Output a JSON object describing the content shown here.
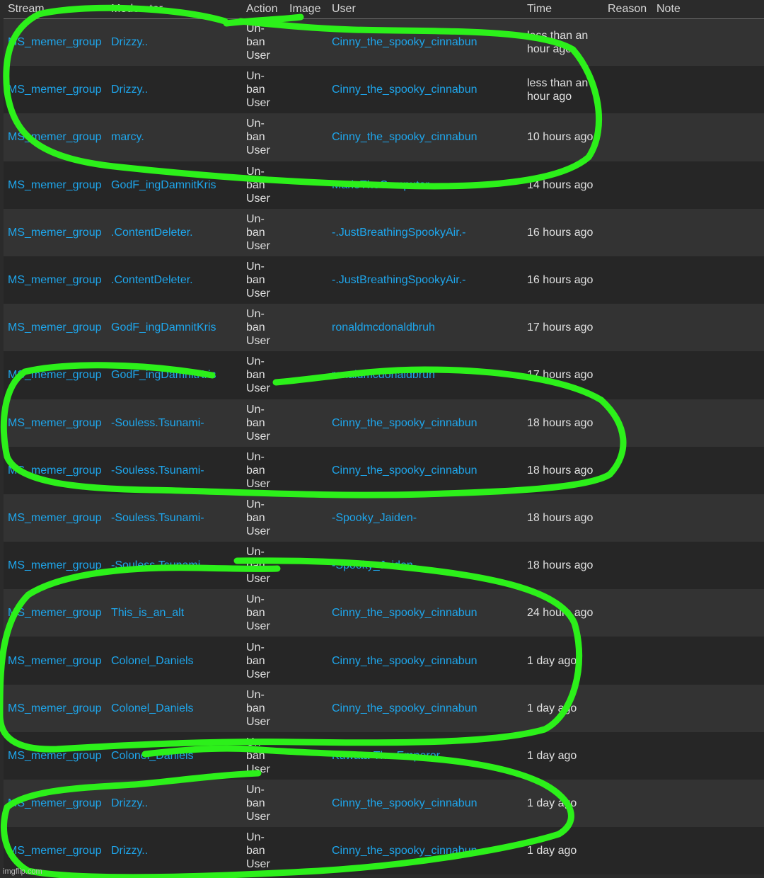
{
  "columns": [
    "Stream",
    "Moderator",
    "Action",
    "Image",
    "User",
    "Time",
    "Reason",
    "Note"
  ],
  "rows": [
    {
      "stream": "MS_memer_group",
      "moderator": "Drizzy..",
      "action": [
        "Un-",
        "ban",
        "User"
      ],
      "user": "Cinny_the_spooky_cinnabun",
      "time": "less than an hour ago"
    },
    {
      "stream": "MS_memer_group",
      "moderator": "Drizzy..",
      "action": [
        "Un-",
        "ban",
        "User"
      ],
      "user": "Cinny_the_spooky_cinnabun",
      "time": "less than an hour ago"
    },
    {
      "stream": "MS_memer_group",
      "moderator": "marcy.",
      "action": [
        "Un-",
        "ban",
        "User"
      ],
      "user": "Cinny_the_spooky_cinnabun",
      "time": "10 hours ago"
    },
    {
      "stream": "MS_memer_group",
      "moderator": "GodF_ingDamnitKris",
      "action": [
        "Un-",
        "ban",
        "User"
      ],
      "user": "MarioTheComputer",
      "time": "14 hours ago"
    },
    {
      "stream": "MS_memer_group",
      "moderator": ".ContentDeleter.",
      "action": [
        "Un-",
        "ban",
        "User"
      ],
      "user": "-.JustBreathingSpookyAir.-",
      "time": "16 hours ago"
    },
    {
      "stream": "MS_memer_group",
      "moderator": ".ContentDeleter.",
      "action": [
        "Un-",
        "ban",
        "User"
      ],
      "user": "-.JustBreathingSpookyAir.-",
      "time": "16 hours ago"
    },
    {
      "stream": "MS_memer_group",
      "moderator": "GodF_ingDamnitKris",
      "action": [
        "Un-",
        "ban",
        "User"
      ],
      "user": "ronaldmcdonaldbruh",
      "time": "17 hours ago"
    },
    {
      "stream": "MS_memer_group",
      "moderator": "GodF_ingDamnitKris",
      "action": [
        "Un-",
        "ban",
        "User"
      ],
      "user": "ronaldmcdonaldbruh",
      "time": "17 hours ago"
    },
    {
      "stream": "MS_memer_group",
      "moderator": "-Souless.Tsunami-",
      "action": [
        "Un-",
        "ban",
        "User"
      ],
      "user": "Cinny_the_spooky_cinnabun",
      "time": "18 hours ago"
    },
    {
      "stream": "MS_memer_group",
      "moderator": "-Souless.Tsunami-",
      "action": [
        "Un-",
        "ban",
        "User"
      ],
      "user": "Cinny_the_spooky_cinnabun",
      "time": "18 hours ago"
    },
    {
      "stream": "MS_memer_group",
      "moderator": "-Souless.Tsunami-",
      "action": [
        "Un-",
        "ban",
        "User"
      ],
      "user": "-Spooky_Jaiden-",
      "time": "18 hours ago"
    },
    {
      "stream": "MS_memer_group",
      "moderator": "-Souless.Tsunami-",
      "action": [
        "Un-",
        "ban",
        "User"
      ],
      "user": "-Spooky_Jaiden-",
      "time": "18 hours ago"
    },
    {
      "stream": "MS_memer_group",
      "moderator": "This_is_an_alt",
      "action": [
        "Un-",
        "ban",
        "User"
      ],
      "user": "Cinny_the_spooky_cinnabun",
      "time": "24 hours ago"
    },
    {
      "stream": "MS_memer_group",
      "moderator": "Colonel_Daniels",
      "action": [
        "Un-",
        "ban",
        "User"
      ],
      "user": "Cinny_the_spooky_cinnabun",
      "time": "1 day ago"
    },
    {
      "stream": "MS_memer_group",
      "moderator": "Colonel_Daniels",
      "action": [
        "Un-",
        "ban",
        "User"
      ],
      "user": "Cinny_the_spooky_cinnabun",
      "time": "1 day ago"
    },
    {
      "stream": "MS_memer_group",
      "moderator": "Colonel_Daniels",
      "action": [
        "Un-",
        "ban",
        "User"
      ],
      "user": "Kuwata-The-Emperor",
      "time": "1 day ago"
    },
    {
      "stream": "MS_memer_group",
      "moderator": "Drizzy..",
      "action": [
        "Un-",
        "ban",
        "User"
      ],
      "user": "Cinny_the_spooky_cinnabun",
      "time": "1 day ago"
    },
    {
      "stream": "MS_memer_group",
      "moderator": "Drizzy..",
      "action": [
        "Un-",
        "ban",
        "User"
      ],
      "user": "Cinny_the_spooky_cinnabun",
      "time": "1 day ago"
    }
  ],
  "watermark": "imgflip.com",
  "colors": {
    "link": "#1ea6ec",
    "scribble": "#2cf01a",
    "row_odd": "#333333",
    "row_even": "#262626"
  }
}
